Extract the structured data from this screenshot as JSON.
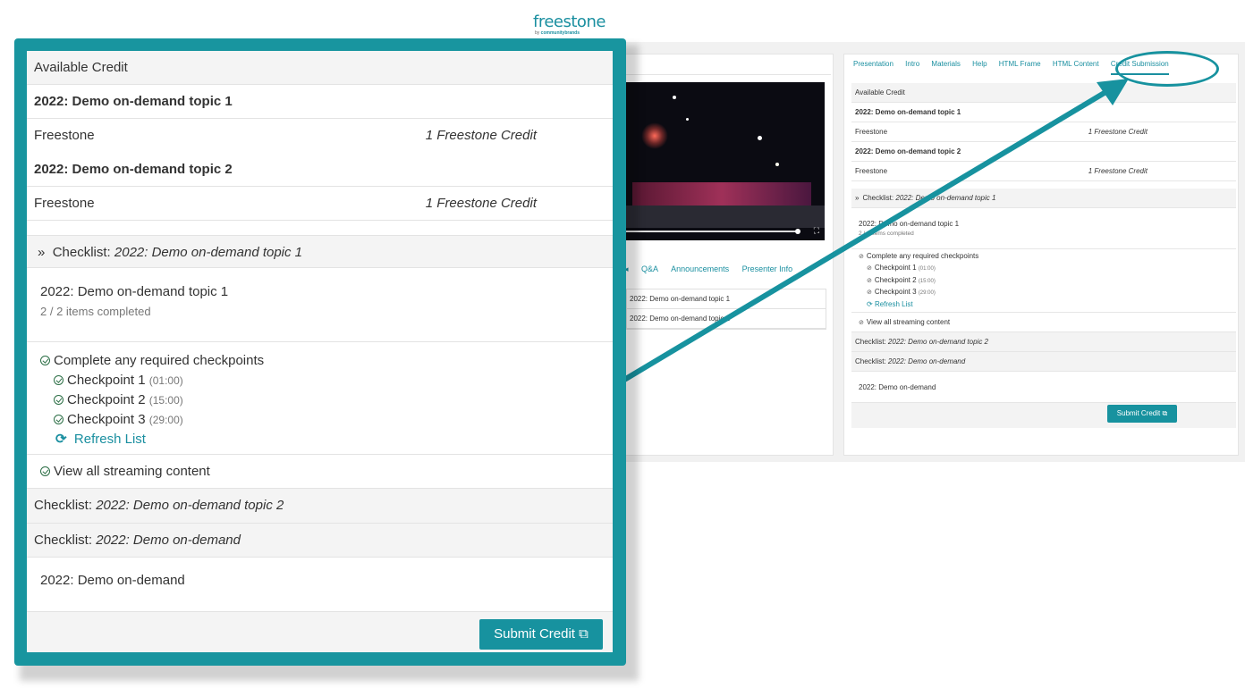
{
  "logo": {
    "word": "freestone",
    "by": "by",
    "brand": "communitybrands"
  },
  "video_tabs": [
    "Q&A",
    "Announcements",
    "Presenter Info"
  ],
  "video_list": [
    "2022: Demo on-demand topic 1",
    "2022: Demo on-demand topic 2"
  ],
  "right_tabs": [
    "Presentation",
    "Intro",
    "Materials",
    "Help",
    "HTML Frame",
    "HTML Content",
    "Credit Submission"
  ],
  "credit": {
    "available_label": "Available Credit",
    "topics": [
      {
        "title": "2022: Demo on-demand topic 1",
        "provider": "Freestone",
        "amount": "1 Freestone Credit"
      },
      {
        "title": "2022: Demo on-demand topic 2",
        "provider": "Freestone",
        "amount": "1 Freestone Credit"
      }
    ]
  },
  "checklists": {
    "prefix": "Checklist:",
    "first": {
      "name": "2022: Demo on-demand topic 1",
      "item_title": "2022: Demo on-demand topic 1",
      "progress": "2 / 2 items completed",
      "requirement": "Complete any required checkpoints",
      "checkpoints": [
        {
          "label": "Checkpoint 1",
          "time": "(01:00)"
        },
        {
          "label": "Checkpoint 2",
          "time": "(15:00)"
        },
        {
          "label": "Checkpoint 3",
          "time": "(29:00)"
        }
      ],
      "refresh": "Refresh List",
      "streaming": "View all streaming content"
    },
    "second": {
      "name": "2022: Demo on-demand topic 2"
    },
    "third": {
      "name": "2022: Demo on-demand",
      "item_title": "2022: Demo on-demand"
    }
  },
  "submit_label": "Submit Credit",
  "colors": {
    "accent": "#17929f",
    "check": "#2b6e45"
  }
}
